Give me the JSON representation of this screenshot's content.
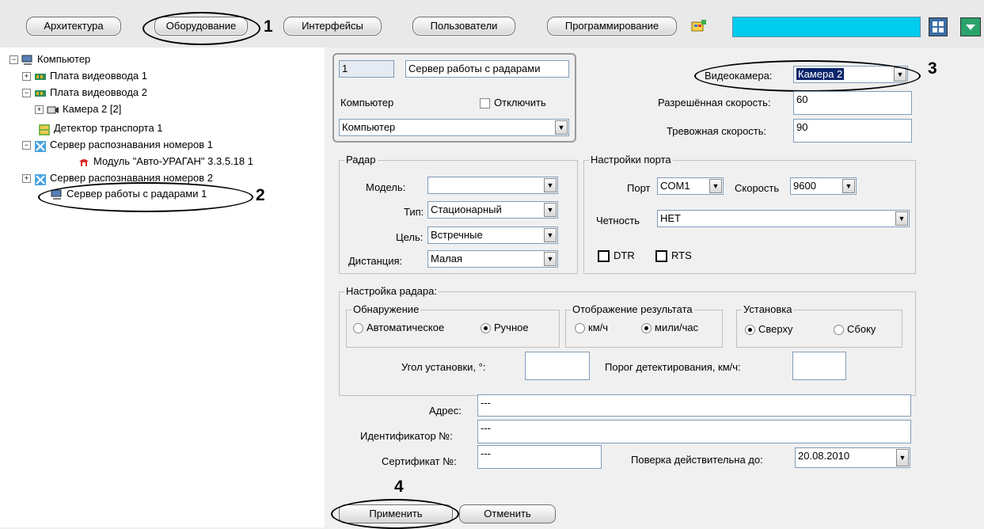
{
  "toolbar": {
    "tabs": [
      "Архитектура",
      "Оборудование",
      "Интерфейсы",
      "Пользователи",
      "Программирование"
    ],
    "search_value": ""
  },
  "annotations": {
    "n1": "1",
    "n2": "2",
    "n3": "3",
    "n4": "4"
  },
  "tree": {
    "items": [
      "Компьютер",
      "Плата видеоввода 1",
      "Плата видеоввода 2",
      "Камера 2 [2]",
      "Детектор транспорта 1",
      "Сервер распознавания номеров 1",
      "Модуль \"Авто-УРАГАН\" 3.3.5.18 1",
      "Сервер распознавания номеров 2",
      "Сервер работы с радарами 1"
    ]
  },
  "object": {
    "id": "1",
    "name": "Сервер работы с радарами",
    "computer_label": "Компьютер",
    "disable_label": "Отключить",
    "computer_value": "Компьютер"
  },
  "camera": {
    "label": "Видеокамера:",
    "value": "Камера 2",
    "allowed_speed_label": "Разрешённая скорость:",
    "allowed_speed": "60",
    "alarm_speed_label": "Тревожная скорость:",
    "alarm_speed": "90"
  },
  "radar": {
    "title": "Радар",
    "model_label": "Модель:",
    "model_value": "",
    "type_label": "Тип:",
    "type_value": "Стационарный",
    "target_label": "Цель:",
    "target_value": "Встречные",
    "distance_label": "Дистанция:",
    "distance_value": "Малая"
  },
  "port": {
    "title": "Настройки порта",
    "port_label": "Порт",
    "port_value": "COM1",
    "speed_label": "Скорость",
    "speed_value": "9600",
    "parity_label": "Четность",
    "parity_value": "НЕТ",
    "dtr_label": "DTR",
    "rts_label": "RTS"
  },
  "radar_setup": {
    "title": "Настройка радара:",
    "detection_title": "Обнаружение",
    "auto_label": "Автоматическое",
    "manual_label": "Ручное",
    "display_title": "Отображение результата",
    "kmh_label": "км/ч",
    "mph_label": "мили/час",
    "install_title": "Установка",
    "top_label": "Сверху",
    "side_label": "Сбоку",
    "angle_label": "Угол установки, °:",
    "angle_value": "",
    "threshold_label": "Порог детектирования, км/ч:",
    "threshold_value": ""
  },
  "details": {
    "address_label": "Адрес:",
    "address_value": "---",
    "ident_label": "Идентификатор №:",
    "ident_value": "---",
    "cert_label": "Сертификат №:",
    "cert_value": "---",
    "valid_label": "Поверка действительна до:",
    "valid_value": "20.08.2010"
  },
  "buttons": {
    "apply": "Применить",
    "cancel": "Отменить"
  },
  "colors": {
    "search_fill": "#00ccee",
    "selection": "#0a246a",
    "field_border": "#7f9db9"
  }
}
